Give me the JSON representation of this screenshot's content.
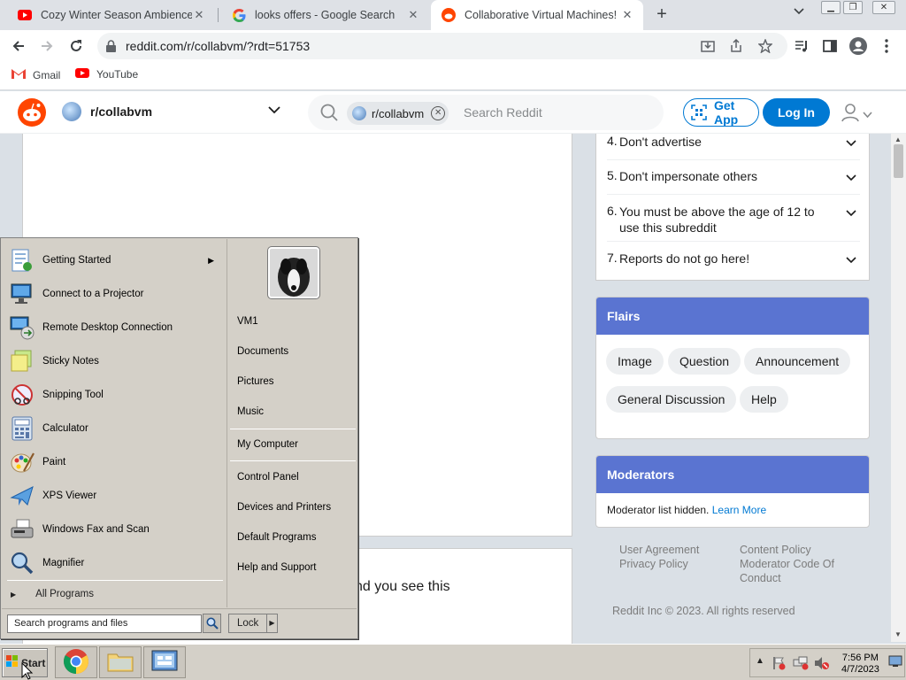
{
  "browser": {
    "tabs": [
      {
        "title": "Cozy Winter Season Ambience - ",
        "favicon": "youtube-icon",
        "active": false
      },
      {
        "title": "looks offers - Google Search",
        "favicon": "google-icon",
        "active": false
      },
      {
        "title": "Collaborative Virtual Machines!",
        "favicon": "reddit-icon",
        "active": true
      }
    ],
    "new_tab": "+",
    "url": "reddit.com/r/collabvm/?rdt=51753",
    "bookmarks": [
      {
        "label": "Gmail",
        "icon": "gmail-icon"
      },
      {
        "label": "YouTube",
        "icon": "youtube-icon"
      }
    ]
  },
  "reddit": {
    "subreddit": "r/collabvm",
    "search_chip": "r/collabvm",
    "search_placeholder": "Search Reddit",
    "get_app": "Get App",
    "login": "Log In",
    "rules": [
      {
        "num": "4.",
        "text": "Don't advertise"
      },
      {
        "num": "5.",
        "text": "Don't impersonate others"
      },
      {
        "num": "6.",
        "text": "You must be above the age of 12 to use this subreddit"
      },
      {
        "num": "7.",
        "text": "Reports do not go here!"
      }
    ],
    "flairs_title": "Flairs",
    "flairs": [
      "Image",
      "Question",
      "Announcement",
      "General Discussion",
      "Help"
    ],
    "moderators_title": "Moderators",
    "moderators_text": "Moderator list hidden.",
    "learn_more": "Learn More",
    "footer_links": [
      "User Agreement",
      "Privacy Policy",
      "Content Policy",
      "Moderator Code Of Conduct"
    ],
    "copyright": "Reddit Inc © 2023. All rights reserved",
    "post_partial_text": "nd you see this"
  },
  "start_menu": {
    "programs": [
      {
        "label": "Getting Started",
        "icon": "getting-started-icon",
        "submenu": true
      },
      {
        "label": "Connect to a Projector",
        "icon": "projector-icon",
        "submenu": false
      },
      {
        "label": "Remote Desktop Connection",
        "icon": "remote-desktop-icon",
        "submenu": false
      },
      {
        "label": "Sticky Notes",
        "icon": "sticky-notes-icon",
        "submenu": false
      },
      {
        "label": "Snipping Tool",
        "icon": "snipping-tool-icon",
        "submenu": false
      },
      {
        "label": "Calculator",
        "icon": "calculator-icon",
        "submenu": false
      },
      {
        "label": "Paint",
        "icon": "paint-icon",
        "submenu": false
      },
      {
        "label": "XPS Viewer",
        "icon": "xps-viewer-icon",
        "submenu": false
      },
      {
        "label": "Windows Fax and Scan",
        "icon": "fax-scan-icon",
        "submenu": false
      },
      {
        "label": "Magnifier",
        "icon": "magnifier-icon",
        "submenu": false
      }
    ],
    "all_programs": "All Programs",
    "right_items": [
      "VM1",
      "Documents",
      "Pictures",
      "Music",
      "My Computer",
      "Control Panel",
      "Devices and Printers",
      "Default Programs",
      "Help and Support"
    ],
    "search_placeholder": "Search programs and files",
    "lock": "Lock"
  },
  "taskbar": {
    "start": "Start",
    "apps": [
      "chrome-icon",
      "explorer-icon",
      "control-panel-icon"
    ],
    "time": "7:56 PM",
    "date": "4/7/2023"
  },
  "colors": {
    "reddit_orange": "#ff4500",
    "reddit_blue": "#0079d3",
    "card_header": "#5a74d1",
    "win_face": "#d4d0c8"
  }
}
